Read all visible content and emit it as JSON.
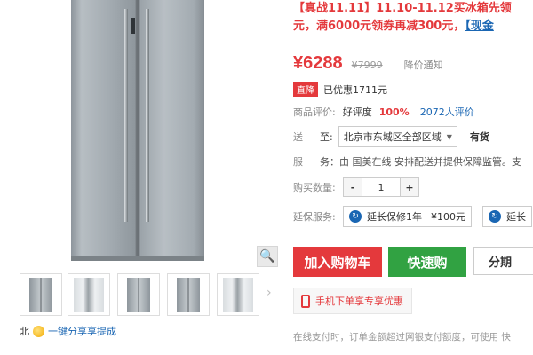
{
  "promo": {
    "line1": "【真战11.11】11.10-11.12买冰箱先领",
    "line2_prefix": "元，满6000元领券再减300元，",
    "line2_link": "【现金"
  },
  "price": {
    "current": "¥6288",
    "original": "¥7999",
    "notify": "降价通知"
  },
  "drop": {
    "badge": "直降",
    "text": "已优惠1711元"
  },
  "rating": {
    "label": "商品评价:",
    "good_label": "好评度",
    "good_value": "100%",
    "reviews": "2072人评价"
  },
  "delivery": {
    "label": "送",
    "to": "至:",
    "location": "北京市东城区全部区域",
    "stock": "有货"
  },
  "service": {
    "label": "服",
    "text": "务：由 国美在线 安排配送并提供保障监管。支"
  },
  "quantity": {
    "label": "购买数量:",
    "minus": "-",
    "value": "1",
    "plus": "+"
  },
  "warranty": {
    "label": "延保服务:",
    "option1": "延长保修1年",
    "option1_price": "¥100元",
    "option2": "延长"
  },
  "buttons": {
    "cart": "加入购物车",
    "quick": "快速购",
    "install": "分期"
  },
  "mobile": {
    "text": "手机下单享专享优惠"
  },
  "footer_note": "在线支付时，订单金额超过网银支付额度，可使用 快",
  "share": {
    "prefix": "北",
    "text": "一键分享享提成"
  },
  "icons": {
    "zoom": "magnifier-icon",
    "next": "chevron-right-icon",
    "coin": "coin-icon",
    "phone": "phone-icon",
    "dropdown": "triangle-down-icon"
  }
}
